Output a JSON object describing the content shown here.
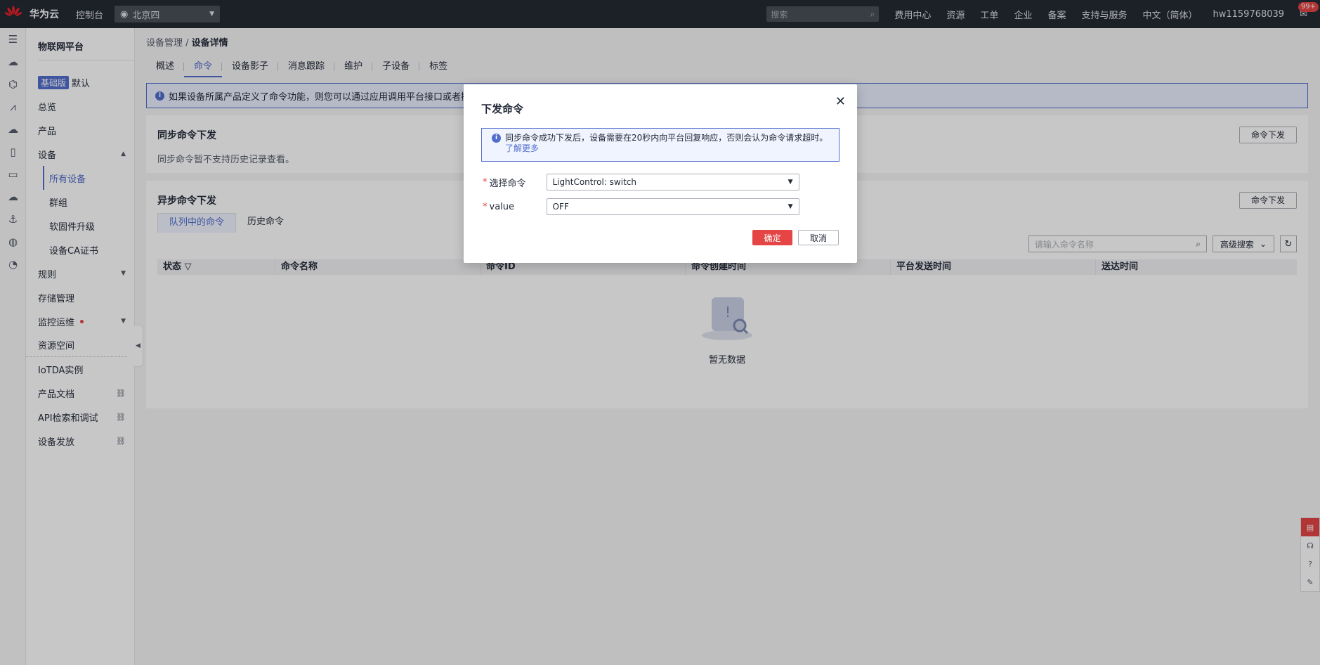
{
  "topbar": {
    "brand": "华为云",
    "console": "控制台",
    "region": "北京四",
    "search_placeholder": "搜索",
    "links": [
      "费用中心",
      "资源",
      "工单",
      "企业",
      "备案",
      "支持与服务",
      "中文（简体）",
      "hw1159768039"
    ],
    "mail_badge": "99+"
  },
  "sidebar": {
    "title": "物联网平台",
    "edition_tag": "基础版",
    "edition_name": "默认",
    "items": {
      "overview": "总览",
      "product": "产品",
      "device": "设备",
      "all_devices": "所有设备",
      "group": "群组",
      "firmware": "软固件升级",
      "ca_cert": "设备CA证书",
      "rules": "规则",
      "storage": "存储管理",
      "monitor": "监控运维",
      "resource_space": "资源空间",
      "iotda": "IoTDA实例",
      "docs": "产品文档",
      "api": "API检索和调试",
      "provision": "设备发放"
    }
  },
  "breadcrumb": {
    "parent": "设备管理 / ",
    "current": "设备详情"
  },
  "tabs": [
    "概述",
    "命令",
    "设备影子",
    "消息跟踪",
    "维护",
    "子设备",
    "标签"
  ],
  "info_banner": "如果设备所属产品定义了命令功能，则您可以通过应用调用平台接口或者操作下",
  "sync_card": {
    "title": "同步命令下发",
    "desc": "同步命令暂不支持历史记录查看。",
    "button": "命令下发"
  },
  "async_card": {
    "title": "异步命令下发",
    "button": "命令下发",
    "subtabs": [
      "队列中的命令",
      "历史命令"
    ],
    "search_placeholder": "请输入命令名称",
    "advanced": "高级搜索",
    "columns": [
      "状态",
      "命令名称",
      "命令ID",
      "命令创建时间",
      "平台发送时间",
      "送达时间"
    ],
    "empty": "暂无数据"
  },
  "dialog": {
    "title": "下发命令",
    "info_text": "同步命令成功下发后，设备需要在20秒内向平台回复响应，否则会认为命令请求超时。",
    "learn_more": "了解更多",
    "field_command_label": "选择命令",
    "field_command_value": "LightControl: switch",
    "field_value_label": "value",
    "field_value_value": "OFF",
    "confirm": "确定",
    "cancel": "取消"
  }
}
